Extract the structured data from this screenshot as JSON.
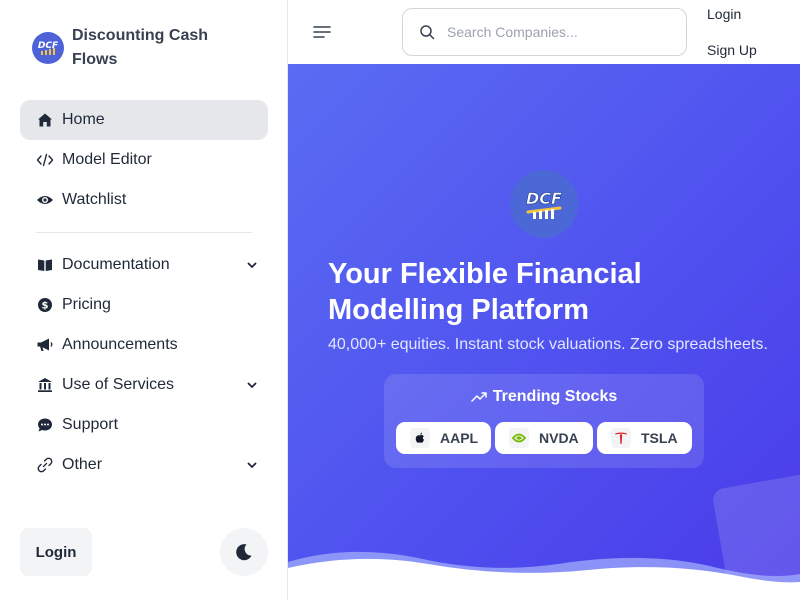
{
  "brand": {
    "name": "Discounting Cash Flows",
    "logo_text": "DCF"
  },
  "sidebar": {
    "items": [
      {
        "label": "Home",
        "icon": "home-icon",
        "active": true,
        "has_submenu": false
      },
      {
        "label": "Model Editor",
        "icon": "code-icon",
        "active": false,
        "has_submenu": false
      },
      {
        "label": "Watchlist",
        "icon": "eye-icon",
        "active": false,
        "has_submenu": false
      }
    ],
    "items2": [
      {
        "label": "Documentation",
        "icon": "book-icon",
        "has_submenu": true
      },
      {
        "label": "Pricing",
        "icon": "dollar-icon",
        "has_submenu": false
      },
      {
        "label": "Announcements",
        "icon": "megaphone-icon",
        "has_submenu": false
      },
      {
        "label": "Use of Services",
        "icon": "bank-icon",
        "has_submenu": true
      },
      {
        "label": "Support",
        "icon": "chat-icon",
        "has_submenu": false
      },
      {
        "label": "Other",
        "icon": "link-icon",
        "has_submenu": true
      }
    ],
    "login_label": "Login",
    "theme_icon": "moon-icon"
  },
  "topbar": {
    "search_placeholder": "Search Companies...",
    "login_label": "Login",
    "signup_label": "Sign Up"
  },
  "hero": {
    "title": "Your Flexible Financial Modelling Platform",
    "subtitle": "40,000+ equities. Instant stock valuations. Zero spreadsheets.",
    "trending_title": "Trending Stocks",
    "stocks": [
      {
        "ticker": "AAPL",
        "icon": "apple-icon"
      },
      {
        "ticker": "NVDA",
        "icon": "nvidia-icon"
      },
      {
        "ticker": "TSLA",
        "icon": "tesla-icon"
      }
    ]
  },
  "colors": {
    "hero_start": "#5a6cf2",
    "hero_end": "#4a3ae8",
    "active_bg": "#e5e7eb",
    "logo_bg": "#4f63d8"
  }
}
